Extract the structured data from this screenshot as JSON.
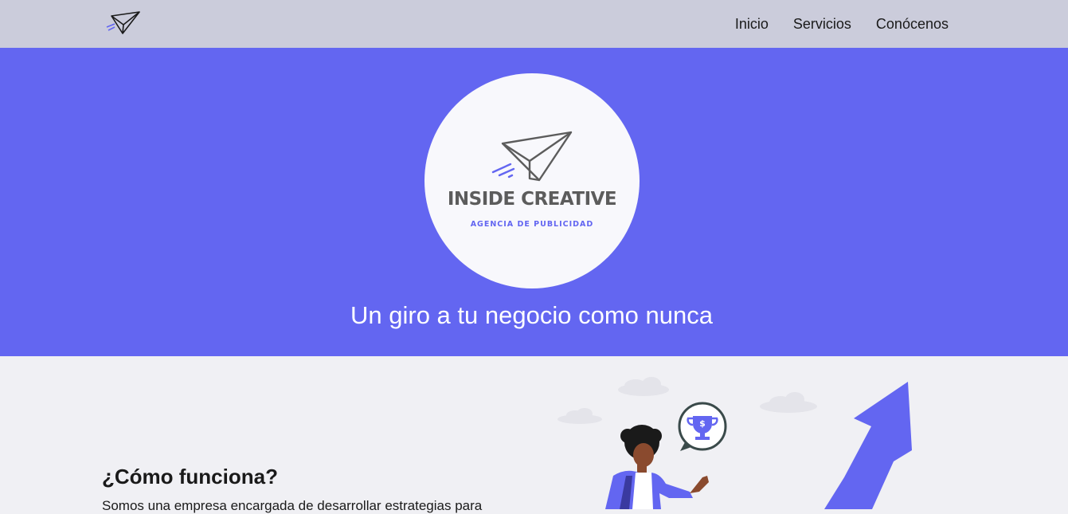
{
  "nav": {
    "logo_icon": "paper-plane-icon",
    "links": [
      {
        "label": "Inicio"
      },
      {
        "label": "Servicios"
      },
      {
        "label": "Conócenos"
      }
    ]
  },
  "hero": {
    "brand_name": "INSIDE CREATIVE",
    "brand_tagline": "AGENCIA DE PUBLICIDAD",
    "heading": "Un giro a tu negocio como nunca",
    "logo_icon": "paper-plane-icon"
  },
  "about": {
    "title": "¿Cómo funciona?",
    "text": "Somos una empresa encargada de desarrollar estrategias para"
  },
  "colors": {
    "accent": "#6366f1",
    "navbar": "#cbccdb",
    "background": "#f0f0f4",
    "text": "#1a1a1a"
  }
}
